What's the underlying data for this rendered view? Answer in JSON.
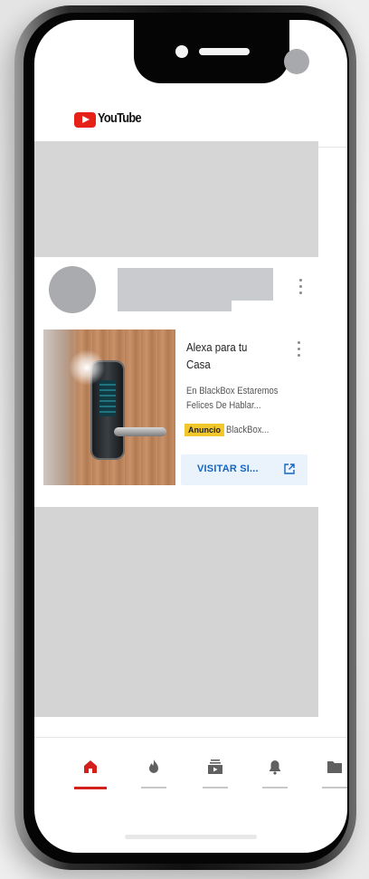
{
  "app": {
    "name": "YouTube",
    "logo_text": "YouTube"
  },
  "colors": {
    "brand_red": "#e62117",
    "link_blue": "#1565c0",
    "ad_badge": "#f2c72c",
    "placeholder_gray": "#d6d6d6"
  },
  "ad": {
    "title": "Alexa para tu Casa",
    "description": "En BlackBox Estaremos Felices De Hablar...",
    "badge": "Anuncio",
    "advertiser": "BlackBox...",
    "cta_label": "VISITAR SI...",
    "cta_icon": "external-link-icon"
  },
  "bottom_nav": [
    {
      "id": "home",
      "icon": "home-icon",
      "active": true
    },
    {
      "id": "trending",
      "icon": "trending-flame-icon",
      "active": false
    },
    {
      "id": "subscriptions",
      "icon": "subscriptions-icon",
      "active": false
    },
    {
      "id": "notifications",
      "icon": "bell-icon",
      "active": false
    },
    {
      "id": "library",
      "icon": "folder-icon",
      "active": false
    }
  ]
}
